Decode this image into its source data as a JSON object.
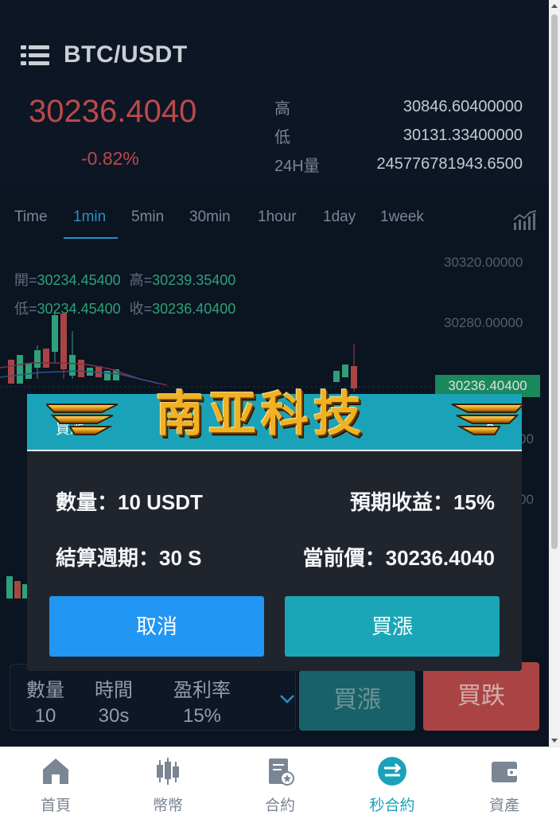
{
  "header": {
    "pair": "BTC/USDT",
    "last_price": "30236.4040",
    "change_pct": "-0.82%",
    "stats": [
      {
        "label": "高",
        "value": "30846.60400000"
      },
      {
        "label": "低",
        "value": "30131.33400000"
      },
      {
        "label": "24H量",
        "value": "245776781943.6500"
      }
    ]
  },
  "tabs": [
    "Time",
    "1min",
    "5min",
    "30min",
    "1hour",
    "1day",
    "1week"
  ],
  "active_tab": "1min",
  "chart": {
    "ohlc": {
      "open_label": "開=",
      "open": "30234.45400",
      "high_label": "高=",
      "high": "30239.35400",
      "low_label": "低=",
      "low": "30234.45400",
      "close_label": "收=",
      "close": "30236.40400"
    },
    "y_ticks": [
      "30320.00000",
      "30280.00000",
      "00",
      "00"
    ],
    "current_price_tag": "30236.40400"
  },
  "trade_bar": {
    "quantity_label": "數量",
    "quantity_value": "10",
    "time_label": "時間",
    "time_value": "30s",
    "profit_label": "盈利率",
    "profit_value": "15%",
    "buy_up": "買漲",
    "buy_down": "買跌"
  },
  "modal": {
    "title": "買漲",
    "banner": "南亚科技",
    "amount": "數量：10 USDT",
    "expected_return": "預期收益：15%",
    "period": "結算週期：30 S",
    "current_price": "當前價：30236.4040",
    "cancel": "取消",
    "confirm": "買漲"
  },
  "bottom_nav": [
    {
      "label": "首頁",
      "icon": "home-icon"
    },
    {
      "label": "幣幣",
      "icon": "candlestick-icon"
    },
    {
      "label": "合約",
      "icon": "contract-icon"
    },
    {
      "label": "秒合約",
      "icon": "exchange-icon",
      "active": true
    },
    {
      "label": "資產",
      "icon": "wallet-icon"
    }
  ],
  "colors": {
    "down": "#d65454",
    "up": "#35b88a",
    "accent": "#1aa3b8",
    "blue": "#2196f3"
  }
}
